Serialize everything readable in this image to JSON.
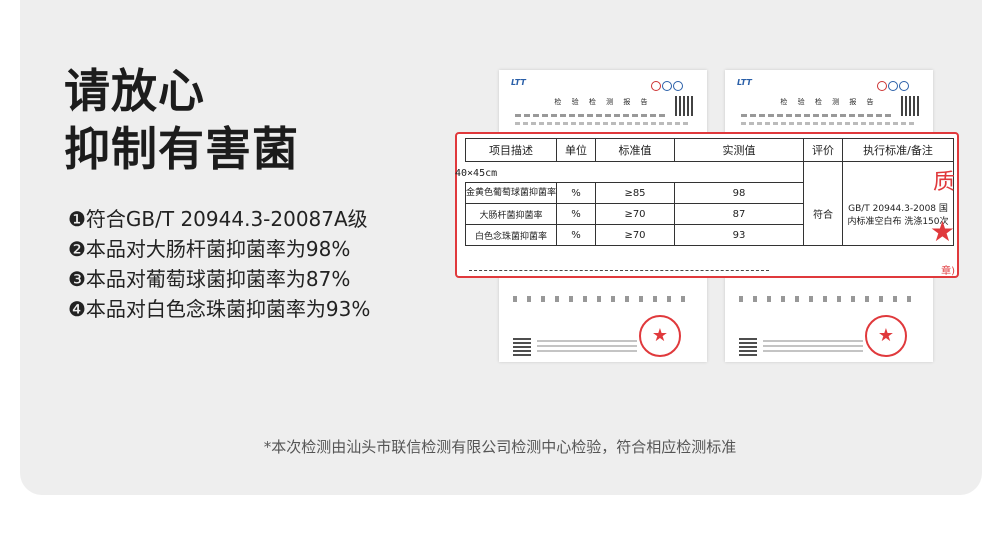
{
  "headline": {
    "line1": "请放心",
    "line2": "抑制有害菌"
  },
  "points": [
    "❶符合GB/T 20944.3-20087A级",
    "❷本品对大肠杆菌抑菌率为98%",
    "❸本品对葡萄球菌抑菌率为87%",
    "❹本品对白色念珠菌抑菌率为93%"
  ],
  "footnote": "*本次检测由汕头市联信检测有限公司检测中心检验，符合相应检测标准",
  "sheet": {
    "logo": "LTT",
    "title": "检 验 检 测 报 告",
    "stamp_glyph": "★"
  },
  "report": {
    "headers": [
      "项目描述",
      "单位",
      "标准值",
      "实测值",
      "评价",
      "执行标准/备注"
    ],
    "size": "40×45cm",
    "rows": [
      {
        "item": "金黄色葡萄球菌抑菌率",
        "unit": "%",
        "standard": "≥85",
        "measured": "98"
      },
      {
        "item": "大肠杆菌抑菌率",
        "unit": "%",
        "standard": "≥70",
        "measured": "87"
      },
      {
        "item": "白色念珠菌抑菌率",
        "unit": "%",
        "standard": "≥70",
        "measured": "93"
      }
    ],
    "evaluation": "符合",
    "remark": "GB/T 20944.3-2008 国内标准空白布 洗涤150次",
    "stamp_char": "质",
    "stamp_star": "★",
    "stamp_tail": "章)"
  }
}
